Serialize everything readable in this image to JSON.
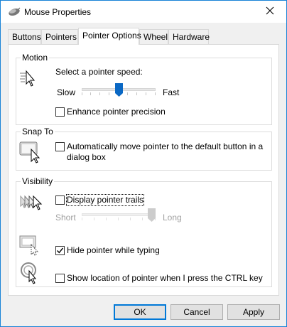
{
  "window": {
    "title": "Mouse Properties"
  },
  "tabs": [
    "Buttons",
    "Pointers",
    "Pointer Options",
    "Wheel",
    "Hardware"
  ],
  "motion": {
    "group_label": "Motion",
    "speed_label": "Select a pointer speed:",
    "slow_label": "Slow",
    "fast_label": "Fast",
    "speed_value": 0.5,
    "precision_label": "Enhance pointer precision",
    "precision_checked": false
  },
  "snap_to": {
    "group_label": "Snap To",
    "auto_move_label_line1": "Automatically move pointer to the default button in a",
    "auto_move_label_line2": "dialog box",
    "auto_move_checked": false
  },
  "visibility": {
    "group_label": "Visibility",
    "trails_label": "Display pointer trails",
    "trails_checked": false,
    "short_label": "Short",
    "long_label": "Long",
    "trail_length_value": 1.0,
    "hide_typing_label": "Hide pointer while typing",
    "hide_typing_checked": true,
    "show_location_label": "Show location of pointer when I press the CTRL key",
    "show_location_checked": false
  },
  "buttons": {
    "ok": "OK",
    "cancel": "Cancel",
    "apply": "Apply"
  },
  "colors": {
    "accent": "#0078d7",
    "window_border": "#1883d7",
    "slider_thumb": "#0a68c4"
  },
  "icons": [
    "mouse-icon",
    "close-icon",
    "pointer-speed-icon",
    "snap-to-button-icon",
    "pointer-trails-icon",
    "hide-pointer-icon",
    "pointer-location-icon"
  ]
}
